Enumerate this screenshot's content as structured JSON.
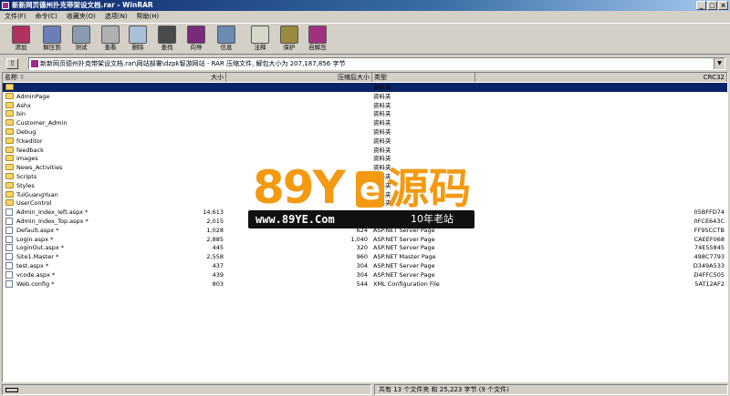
{
  "window": {
    "title": "新新网页德州扑克带架设文档.rar - WinRAR",
    "min": "_",
    "max": "□",
    "close": "×"
  },
  "menu": [
    "文件(F)",
    "命令(C)",
    "收藏夹(O)",
    "选项(N)",
    "帮助(H)"
  ],
  "toolbar": [
    {
      "label": "添加",
      "color": "#b03060"
    },
    {
      "label": "解压到",
      "color": "#6a7fb8"
    },
    {
      "label": "测试",
      "color": "#8a9bb0"
    },
    {
      "label": "查看",
      "color": "#b0b0b0"
    },
    {
      "label": "删除",
      "color": "#a8c0d8"
    },
    {
      "label": "查找",
      "color": "#4a4a4a"
    },
    {
      "label": "向导",
      "color": "#7a2a7a"
    },
    {
      "label": "信息",
      "color": "#6a8ab0"
    },
    {
      "label": "注释",
      "color": "#d8d8c8"
    },
    {
      "label": "保护",
      "color": "#9a8a40"
    },
    {
      "label": "自解压",
      "color": "#a03080"
    }
  ],
  "path": "新新网页德州扑克带架设文档.rar\\网站部署\\dzpk智游网站 - RAR 压缩文件, 解包大小为 207,187,856 字节",
  "columns": {
    "name": "名称",
    "size": "大小",
    "packed": "压缩后大小",
    "type": "类型",
    "crc": "CRC32"
  },
  "rows": [
    {
      "name": "..",
      "size": "",
      "packed": "",
      "type": "资料夹",
      "crc": "",
      "kind": "folder",
      "selected": true
    },
    {
      "name": "AdminPage",
      "size": "",
      "packed": "",
      "type": "资料夹",
      "crc": "",
      "kind": "folder"
    },
    {
      "name": "Ashx",
      "size": "",
      "packed": "",
      "type": "资料夹",
      "crc": "",
      "kind": "folder"
    },
    {
      "name": "bin",
      "size": "",
      "packed": "",
      "type": "资料夹",
      "crc": "",
      "kind": "folder"
    },
    {
      "name": "Customer_Admin",
      "size": "",
      "packed": "",
      "type": "资料夹",
      "crc": "",
      "kind": "folder"
    },
    {
      "name": "Debug",
      "size": "",
      "packed": "",
      "type": "资料夹",
      "crc": "",
      "kind": "folder"
    },
    {
      "name": "fckeditor",
      "size": "",
      "packed": "",
      "type": "资料夹",
      "crc": "",
      "kind": "folder"
    },
    {
      "name": "feedback",
      "size": "",
      "packed": "",
      "type": "资料夹",
      "crc": "",
      "kind": "folder"
    },
    {
      "name": "images",
      "size": "",
      "packed": "",
      "type": "资料夹",
      "crc": "",
      "kind": "folder"
    },
    {
      "name": "News_Activities",
      "size": "",
      "packed": "",
      "type": "资料夹",
      "crc": "",
      "kind": "folder"
    },
    {
      "name": "Scripts",
      "size": "",
      "packed": "",
      "type": "资料夹",
      "crc": "",
      "kind": "folder"
    },
    {
      "name": "Styles",
      "size": "",
      "packed": "",
      "type": "资料夹",
      "crc": "",
      "kind": "folder"
    },
    {
      "name": "TuiGuangYuan",
      "size": "",
      "packed": "",
      "type": "资料夹",
      "crc": "",
      "kind": "folder"
    },
    {
      "name": "UserControl",
      "size": "",
      "packed": "",
      "type": "资料夹",
      "crc": "",
      "kind": "folder"
    },
    {
      "name": "Admin_Index_left.aspx *",
      "size": "14,613",
      "packed": "",
      "type": "",
      "crc": "05BFFD74",
      "kind": "file"
    },
    {
      "name": "Admin_Index_Top.aspx *",
      "size": "2,015",
      "packed": "",
      "type": "",
      "crc": "0FCE643C",
      "kind": "file"
    },
    {
      "name": "Default.aspx *",
      "size": "1,028",
      "packed": "624",
      "type": "ASP.NET Server Page",
      "crc": "FF95CCTB",
      "kind": "file"
    },
    {
      "name": "Login.aspx *",
      "size": "2,885",
      "packed": "1,040",
      "type": "ASP.NET Server Page",
      "crc": "CAEEF068",
      "kind": "file"
    },
    {
      "name": "LoginOut.aspx *",
      "size": "445",
      "packed": "320",
      "type": "ASP.NET Server Page",
      "crc": "74E55845",
      "kind": "file"
    },
    {
      "name": "Site1.Master *",
      "size": "2,558",
      "packed": "960",
      "type": "ASP.NET Master Page",
      "crc": "498C7793",
      "kind": "file"
    },
    {
      "name": "test.aspx *",
      "size": "437",
      "packed": "304",
      "type": "ASP.NET Server Page",
      "crc": "D349A533",
      "kind": "file"
    },
    {
      "name": "vcode.aspx *",
      "size": "439",
      "packed": "304",
      "type": "ASP.NET Server Page",
      "crc": "D4FFC505",
      "kind": "file"
    },
    {
      "name": "Web.config *",
      "size": "803",
      "packed": "544",
      "type": "XML Configuration File",
      "crc": "5AT12AF2",
      "kind": "file"
    }
  ],
  "watermark": {
    "big": "89Y",
    "e": "e",
    "src": "源码",
    "url": "www.89YE.Com",
    "slogan": "10年老站",
    "color": "#f39a12"
  },
  "status": {
    "right": "共有 13 个文件夹 和 25,223 字节 (9 个文件)"
  }
}
